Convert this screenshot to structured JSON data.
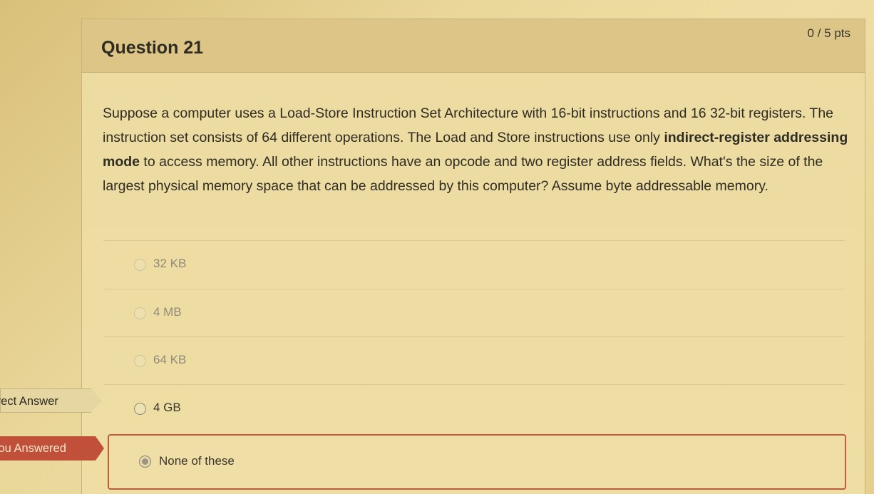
{
  "question": {
    "title": "Question 21",
    "points": "0 / 5 pts",
    "text_1": "Suppose a computer uses a  Load-Store Instruction Set Architecture with 16-bit instructions and 16 32-bit registers. The instruction set consists of 64 different operations. The Load and Store instructions use only ",
    "text_bold": "indirect-register addressing mode",
    "text_2": " to access memory. All other instructions have an opcode and two register address fields. What's the size of the largest physical memory space that can be addressed by this computer? Assume  byte addressable memory."
  },
  "answers": [
    {
      "label": "32 KB"
    },
    {
      "label": "4 MB"
    },
    {
      "label": "64 KB"
    },
    {
      "label": "4 GB"
    },
    {
      "label": "None of these"
    }
  ],
  "tags": {
    "correct_answer": "orrect Answer",
    "you_answered": "You Answered"
  },
  "colors": {
    "you_answered_tag": "#c0503a",
    "selected_border": "#c55a3a"
  }
}
